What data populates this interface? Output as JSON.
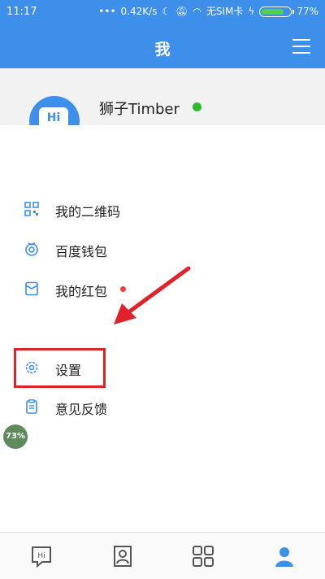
{
  "status": {
    "time": "11:17",
    "speed": "0.42K/s",
    "sim": "无SIM卡",
    "battery": "77%"
  },
  "header": {
    "title": "我"
  },
  "profile": {
    "name": "狮子Timber",
    "avatar_text": "Hi"
  },
  "menu": [
    {
      "label": "我的二维码",
      "icon": "qrcode-icon"
    },
    {
      "label": "百度钱包",
      "icon": "wallet-icon"
    },
    {
      "label": "我的红包",
      "icon": "red-envelope-icon"
    },
    {
      "label": "设置",
      "icon": "gear-icon"
    },
    {
      "label": "意见反馈",
      "icon": "feedback-icon"
    }
  ],
  "floating": {
    "percent": "73%"
  },
  "bottom_nav": [
    {
      "label": "Hi",
      "icon": "chat-icon"
    },
    {
      "label": "",
      "icon": "contacts-icon"
    },
    {
      "label": "",
      "icon": "apps-icon"
    },
    {
      "label": "",
      "icon": "profile-icon"
    }
  ],
  "colors": {
    "primary": "#3e8fe9",
    "highlight": "#e0222a",
    "online": "#2dbb31"
  }
}
